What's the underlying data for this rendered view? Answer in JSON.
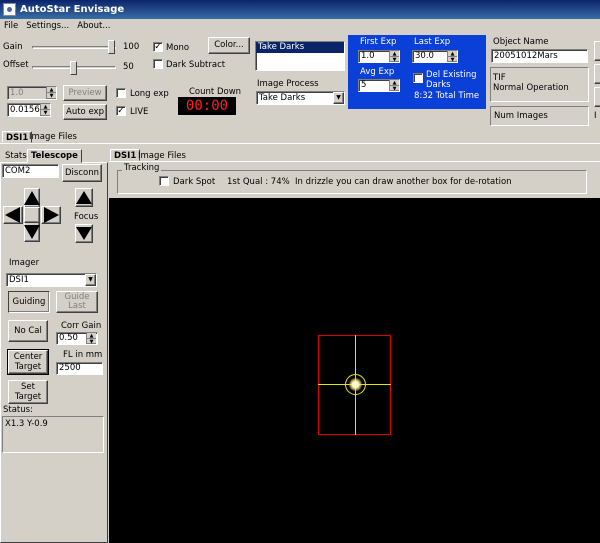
{
  "window": {
    "title": "AutoStar Envisage"
  },
  "menu": [
    "File",
    "Settings...",
    "About..."
  ],
  "camera": {
    "gain_label": "Gain",
    "gain_value": "100",
    "offset_label": "Offset",
    "offset_value": "50",
    "mono_label": "Mono",
    "mono_checked": true,
    "dark_subtract_label": "Dark Subtract",
    "color_button": "Color...",
    "exposure_value": "1.0",
    "exposure2_value": "0.0156",
    "preview_button": "Preview",
    "autoexp_button": "Auto exp",
    "long_exp_label": "Long exp",
    "live_label": "LIVE",
    "live_checked": true,
    "countdown_label": "Count Down",
    "countdown_value": "00:00"
  },
  "process": {
    "list_item": "Take Darks",
    "image_process_label": "Image Process",
    "image_process_value": "Take Darks"
  },
  "exposure_panel": {
    "first_exp_label": "First Exp",
    "first_exp_value": "1.0",
    "last_exp_label": "Last Exp",
    "last_exp_value": "30.0",
    "avg_exp_label": "Avg Exp",
    "avg_exp_value": "5",
    "del_darks_label": "Del Existing Darks",
    "total_time": "8:32 Total Time"
  },
  "object": {
    "name_label": "Object Name",
    "name_value": "20051012Mars",
    "format": "TIF",
    "mode": "Normal Operation",
    "num_images_label": "Num Images"
  },
  "upper_tabs": [
    "DSI1",
    "Image Files"
  ],
  "left_tabs": [
    "Stats",
    "Telescope"
  ],
  "telescope": {
    "port": "COM2",
    "disconn_button": "Disconn",
    "focus_label": "Focus",
    "imager_label": "Imager",
    "imager_value": "DSI1",
    "guiding_button": "Guiding",
    "guide_last_button": "Guide Last",
    "nocal_button": "No Cal",
    "corr_gain_label": "Corr Gain",
    "corr_gain_value": "0.50",
    "center_target_button": "Center Target",
    "fl_label": "FL in mm",
    "fl_value": "2500",
    "set_target_button": "Set Target",
    "status_label": "Status:",
    "status_value": "X1.3 Y-0.9"
  },
  "image_tabs": [
    "DSI1",
    "Image Files"
  ],
  "tracking": {
    "group_label": "Tracking",
    "dark_spot_label": "Dark Spot",
    "qual_text": "1st Qual : 74%",
    "hint_text": "In drizzle you can draw another box for de-rotation"
  },
  "colors": {
    "title_bar": "#0a246a",
    "exposure_panel": "#0a3fd8",
    "countdown_bg": "#000000",
    "countdown_text": "#ff2020",
    "target_box": "#e00000",
    "crosshair": "#e6e600"
  }
}
